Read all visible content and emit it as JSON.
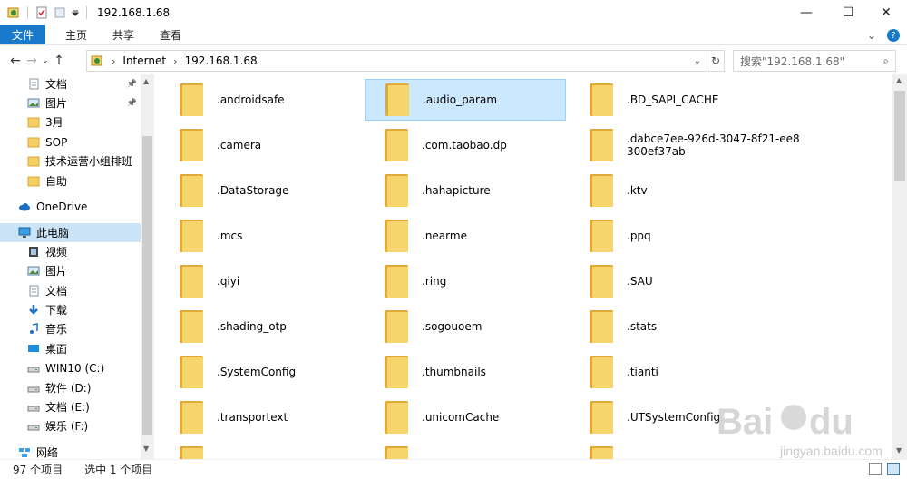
{
  "window": {
    "title": "192.168.1.68",
    "minimize": "—",
    "maximize": "☐",
    "close": "✕"
  },
  "ribbon": {
    "tabs": [
      "文件",
      "主页",
      "共享",
      "查看"
    ]
  },
  "address": {
    "crumbs": [
      "Internet",
      "192.168.1.68"
    ],
    "search_placeholder": "搜索\"192.168.1.68\""
  },
  "nav": {
    "items": [
      {
        "label": "文档",
        "icon": "document-icon",
        "pinned": true
      },
      {
        "label": "图片",
        "icon": "pictures-icon",
        "pinned": true
      },
      {
        "label": "3月",
        "icon": "folder-icon"
      },
      {
        "label": "SOP",
        "icon": "folder-icon"
      },
      {
        "label": "技术运营小组排班",
        "icon": "folder-icon"
      },
      {
        "label": "自助",
        "icon": "folder-icon"
      },
      {
        "label": "OneDrive",
        "icon": "cloud-icon"
      },
      {
        "label": "此电脑",
        "icon": "computer-icon",
        "selected": true
      },
      {
        "label": "视频",
        "icon": "video-icon"
      },
      {
        "label": "图片",
        "icon": "pictures-icon"
      },
      {
        "label": "文档",
        "icon": "document-icon"
      },
      {
        "label": "下载",
        "icon": "download-icon"
      },
      {
        "label": "音乐",
        "icon": "music-icon"
      },
      {
        "label": "桌面",
        "icon": "desktop-icon"
      },
      {
        "label": "WIN10 (C:)",
        "icon": "drive-icon"
      },
      {
        "label": "软件 (D:)",
        "icon": "drive-icon"
      },
      {
        "label": "文档 (E:)",
        "icon": "drive-icon"
      },
      {
        "label": "娱乐 (F:)",
        "icon": "drive-icon"
      },
      {
        "label": "网络",
        "icon": "network-icon"
      }
    ]
  },
  "files": [
    ".androidsafe",
    ".audio_param",
    ".BD_SAPI_CACHE",
    ".camera",
    ".com.taobao.dp",
    ".dabce7ee-926d-3047-8f21-ee8\n300ef37ab",
    ".DataStorage",
    ".hahapicture",
    ".ktv",
    ".mcs",
    ".nearme",
    ".ppq",
    ".qiyi",
    ".ring",
    ".SAU",
    ".shading_otp",
    ".sogouoem",
    ".stats",
    ".SystemConfig",
    ".thumbnails",
    ".tianti",
    ".transportext",
    ".unicomCache",
    ".UTSystemConfig",
    "",
    "",
    ""
  ],
  "selected_file": ".audio_param",
  "status": {
    "count": "97 个项目",
    "selection": "选中 1 个项目"
  },
  "watermark": {
    "brand": "Bai du 经验",
    "url": "jingyan.baidu.com"
  },
  "colors": {
    "accent": "#1979ca",
    "selection": "#cce8ff",
    "folder": "#f7d56d"
  }
}
